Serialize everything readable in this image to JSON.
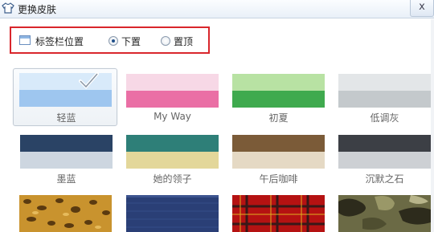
{
  "window": {
    "title": "更换皮肤",
    "close_label": "x"
  },
  "tab_position": {
    "label": "标签栏位置",
    "options": [
      {
        "label": "下置",
        "checked": true
      },
      {
        "label": "置顶",
        "checked": false
      }
    ]
  },
  "skins": [
    {
      "name": "轻蓝",
      "selected": true,
      "top": "#d8eafa",
      "bottom": "#9ec6ef"
    },
    {
      "name": "My Way",
      "selected": false,
      "top": "#f7d8e6",
      "bottom": "#ea6fa5"
    },
    {
      "name": "初夏",
      "selected": false,
      "top": "#b8e2a3",
      "bottom": "#3faa4e"
    },
    {
      "name": "低调灰",
      "selected": false,
      "top": "#e3e6e8",
      "bottom": "#c4c9cc"
    },
    {
      "name": "墨蓝",
      "selected": false,
      "top": "#2a4365",
      "bottom": "#cdd6e0"
    },
    {
      "name": "她的领子",
      "selected": false,
      "top": "#2e7f78",
      "bottom": "#e3d79a"
    },
    {
      "name": "午后咖啡",
      "selected": false,
      "top": "#7b5b38",
      "bottom": "#e5d9c4"
    },
    {
      "name": "沉默之石",
      "selected": false,
      "top": "#3c3f45",
      "bottom": "#cdd0d4"
    }
  ],
  "patterns": [
    "leopard",
    "navy-texture",
    "red-plaid",
    "camouflage"
  ],
  "colors": {
    "highlight_border": "#d9262c",
    "accent": "#1f4f8a"
  }
}
